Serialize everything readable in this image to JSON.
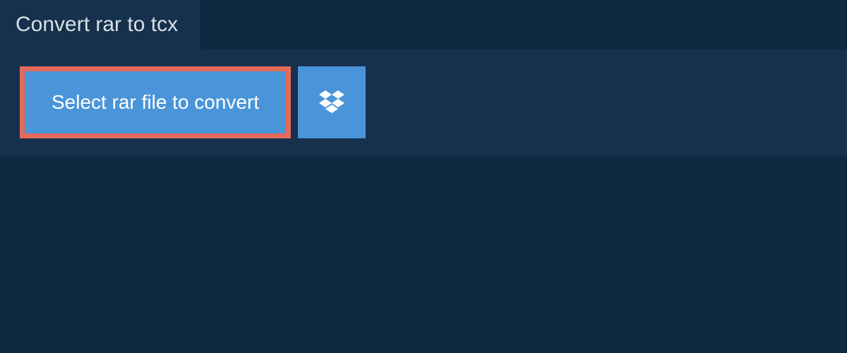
{
  "header": {
    "title": "Convert rar to tcx"
  },
  "actions": {
    "select_file_label": "Select rar file to convert",
    "cloud_source": "dropbox"
  },
  "colors": {
    "background": "#0e2a42",
    "panel": "#15314d",
    "button": "#4a95d9",
    "button_border": "#e46a5a",
    "text_light": "#d9e0e5"
  }
}
